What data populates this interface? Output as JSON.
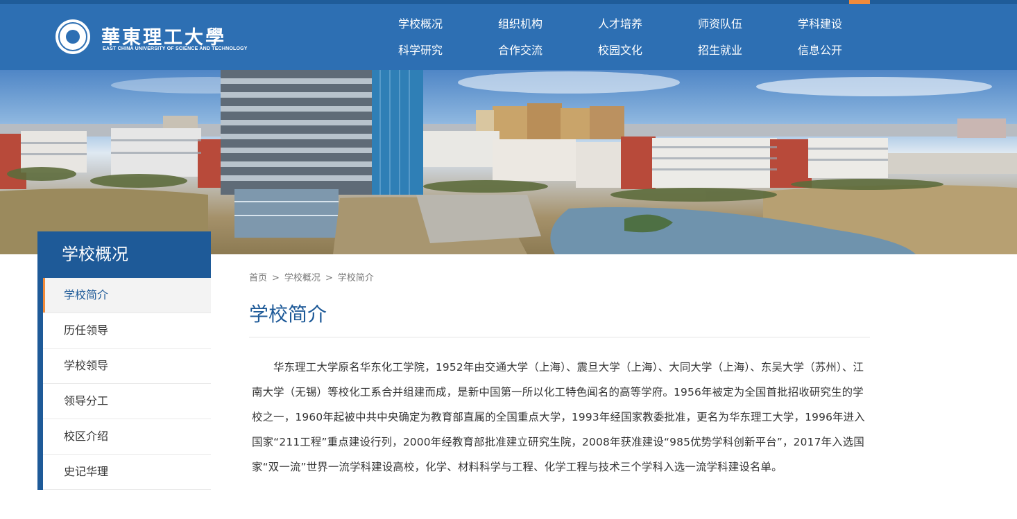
{
  "colors": {
    "header": "#2d6fb3",
    "primary": "#1e5a98",
    "accent": "#f08a3a"
  },
  "logo": {
    "cn": "華東理工大學",
    "en": "EAST CHINA UNIVERSITY OF SCIENCE AND TECHNOLOGY"
  },
  "nav": {
    "row1": [
      "学校概况",
      "组织机构",
      "人才培养",
      "师资队伍",
      "学科建设"
    ],
    "row2": [
      "科学研究",
      "合作交流",
      "校园文化",
      "招生就业",
      "信息公开"
    ]
  },
  "sidebar": {
    "title": "学校概况",
    "items": [
      "学校简介",
      "历任领导",
      "学校领导",
      "领导分工",
      "校区介绍",
      "史记华理"
    ]
  },
  "breadcrumb": {
    "home": "首页",
    "level1": "学校概况",
    "current": "学校简介",
    "separator": ">"
  },
  "page_title": "学校简介",
  "content": "华东理工大学原名华东化工学院，1952年由交通大学（上海）、震旦大学（上海）、大同大学（上海）、东吴大学（苏州）、江南大学（无锡）等校化工系合并组建而成，是新中国第一所以化工特色闻名的高等学府。1956年被定为全国首批招收研究生的学校之一，1960年起被中共中央确定为教育部直属的全国重点大学，1993年经国家教委批准，更名为华东理工大学，1996年进入国家“211工程”重点建设行列，2000年经教育部批准建立研究生院，2008年获准建设“985优势学科创新平台”，2017年入选国家“双一流”世界一流学科建设高校，化学、材料科学与工程、化学工程与技术三个学科入选一流学科建设名单。"
}
